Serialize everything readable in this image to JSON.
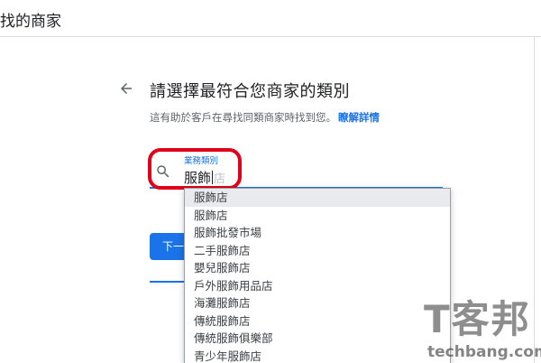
{
  "topbar": {
    "title": "找的商家"
  },
  "header": {
    "heading": "請選擇最符合您商家的類別",
    "subtext": "這有助於客戶在尋找同類商家時找到您。",
    "learn_more": "瞭解詳情"
  },
  "search_field": {
    "label": "業務類別",
    "value": "服飾",
    "ghost": "店"
  },
  "next_button": {
    "label": "下一步"
  },
  "suggestions": [
    "服飾店",
    "服飾店",
    "服飾批發市場",
    "二手服飾店",
    "嬰兒服飾店",
    "戶外服飾用品店",
    "海灘服飾店",
    "傳統服飾店",
    "傳統服飾俱樂部",
    "青少年服飾店"
  ],
  "watermark": {
    "logo_text": "T客邦",
    "domain": "techbang.com"
  },
  "colors": {
    "accent": "#1a73e8",
    "highlight": "#e0001a"
  },
  "icons": {
    "back": "arrow-left-icon",
    "search": "search-icon"
  }
}
